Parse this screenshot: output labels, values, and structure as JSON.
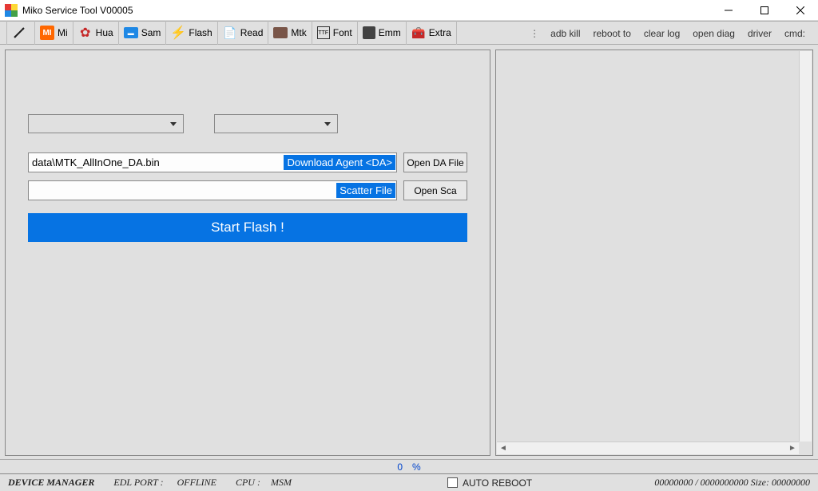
{
  "window": {
    "title": "Miko Service Tool V00005"
  },
  "toolbar": {
    "items": [
      {
        "label": "Mi"
      },
      {
        "label": "Hua"
      },
      {
        "label": "Sam"
      },
      {
        "label": "Flash"
      },
      {
        "label": "Read"
      },
      {
        "label": "Mtk"
      },
      {
        "label": "Font"
      },
      {
        "label": "Emm"
      },
      {
        "label": "Extra"
      }
    ]
  },
  "right_actions": {
    "adb_kill": "adb kill",
    "reboot_to": "reboot to",
    "clear_log": "clear log",
    "open_diag": "open diag",
    "driver": "driver",
    "cmd": "cmd:"
  },
  "form": {
    "da_path": "data\\MTK_AllInOne_DA.bin",
    "da_badge": "Download Agent <DA>",
    "scatter_path": "",
    "scatter_badge": "Scatter File",
    "open_da_label": "Open DA File",
    "open_sca_label": "Open Sca",
    "start_label": "Start Flash !"
  },
  "midbar": {
    "left_num": "0",
    "right_sym": "%"
  },
  "status": {
    "device_manager": "DEVICE MANAGER",
    "edl_port_label": "EDL PORT :",
    "edl_port_value": "OFFLINE",
    "cpu_label": "CPU :",
    "cpu_value": "MSM",
    "auto_reboot": "AUTO REBOOT",
    "progress": "00000000 / 0000000000 Size: 00000000"
  }
}
